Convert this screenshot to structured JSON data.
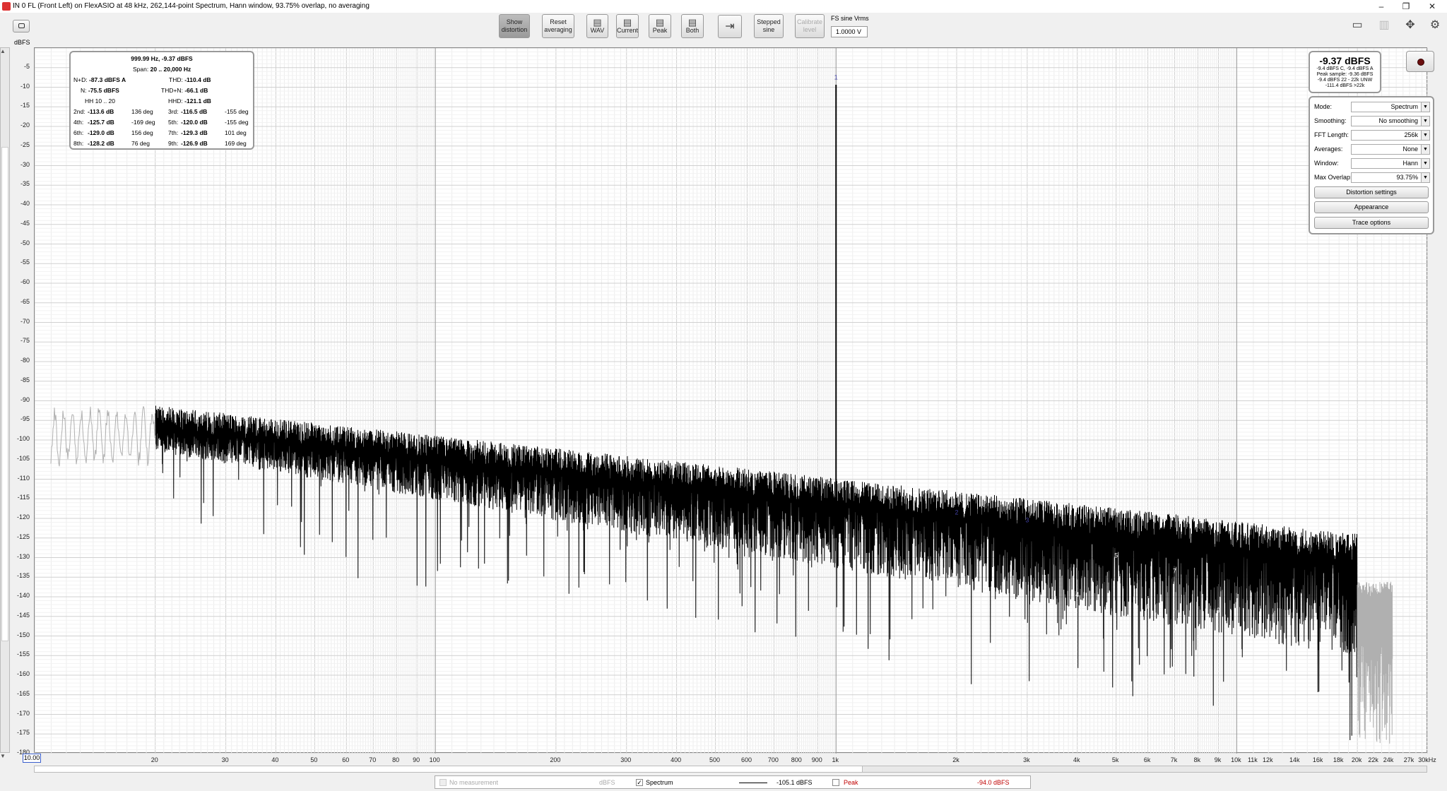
{
  "window": {
    "title": "IN 0 FL (Front Left) on FlexASIO at 48 kHz, 262,144-point Spectrum, Hann window, 93.75% overlap, no averaging",
    "min_glyph": "–",
    "max_glyph": "❐",
    "close_glyph": "✕"
  },
  "toolbar": {
    "show_distortion": [
      "Show",
      "distortion"
    ],
    "reset_averaging": [
      "Reset",
      "averaging"
    ],
    "wav": "WAV",
    "current": "Current",
    "peak": "Peak",
    "both": "Both",
    "stepped_sine": [
      "Stepped",
      "sine"
    ],
    "calibrate_level": [
      "Calibrate",
      "level"
    ],
    "fs_sine_label": "FS sine Vrms",
    "fs_sine_value": "1.0000 V"
  },
  "plot": {
    "y_unit": "dBFS",
    "y_ticks": [
      "-5",
      "-10",
      "-15",
      "-20",
      "-25",
      "-30",
      "-35",
      "-40",
      "-45",
      "-50",
      "-55",
      "-60",
      "-65",
      "-70",
      "-75",
      "-80",
      "-85",
      "-90",
      "-95",
      "-100",
      "-105",
      "-110",
      "-115",
      "-120",
      "-125",
      "-130",
      "-135",
      "-140",
      "-145",
      "-150",
      "-155",
      "-160",
      "-165",
      "-170",
      "-175",
      "-180"
    ],
    "x_start_box": "10.00",
    "x_ticks": [
      "20",
      "30",
      "40",
      "50",
      "60",
      "70",
      "80",
      "90",
      "100",
      "200",
      "300",
      "400",
      "500",
      "600",
      "700",
      "800",
      "900",
      "1k",
      "2k",
      "3k",
      "4k",
      "5k",
      "6k",
      "7k",
      "8k",
      "9k",
      "10k",
      "11k",
      "12k",
      "14k",
      "16k",
      "18k",
      "20k",
      "22k",
      "24k",
      "27k",
      "30kHz"
    ],
    "harmonic_markers": [
      "1",
      "2",
      "3",
      "4",
      "5",
      "6",
      "7",
      "8",
      "9"
    ]
  },
  "info_panel": {
    "header": "999.99 Hz, -9.37 dBFS",
    "span_label": "Span:",
    "span_value": "20 .. 20,000 Hz",
    "nd_label": "N+D:",
    "nd_value": "-87.3 dBFS A",
    "thd_label": "THD:",
    "thd_value": "-110.4 dB",
    "n_label": "N:",
    "n_value": "-75.5 dBFS",
    "thdn_label": "THD+N:",
    "thdn_value": "-66.1 dB",
    "hh_label": "HH 10 .. 20",
    "hhd_label": "HHD:",
    "hhd_value": "-121.1 dB",
    "harmonics": [
      {
        "l": "2nd:",
        "v": "-113.6 dB",
        "p": "136 deg",
        "l2": "3rd:",
        "v2": "-116.5 dB",
        "p2": "-155 deg"
      },
      {
        "l": "4th:",
        "v": "-125.7 dB",
        "p": "-169 deg",
        "l2": "5th:",
        "v2": "-120.0 dB",
        "p2": "-155 deg"
      },
      {
        "l": "6th:",
        "v": "-129.0 dB",
        "p": "156 deg",
        "l2": "7th:",
        "v2": "-129.3 dB",
        "p2": "101 deg"
      },
      {
        "l": "8th:",
        "v": "-128.2 dB",
        "p": "76 deg",
        "l2": "9th:",
        "v2": "-126.9 dB",
        "p2": "169 deg"
      }
    ]
  },
  "meter": {
    "big": "-9.37 dBFS",
    "lines": [
      "-9.4 dBFS C, -9.4 dBFS A",
      "Peak sample: -9.36 dBFS",
      "-9.4 dBFS 22 - 22k UNW",
      "-111.4 dBFS >22k"
    ]
  },
  "controls": {
    "rows": [
      {
        "label": "Mode:",
        "value": "Spectrum"
      },
      {
        "label": "Smoothing:",
        "value": "No  smoothing"
      },
      {
        "label": "FFT Length:",
        "value": "256k"
      },
      {
        "label": "Averages:",
        "value": "None"
      },
      {
        "label": "Window:",
        "value": "Hann"
      },
      {
        "label": "Max Overlap:",
        "value": "93.75%"
      }
    ],
    "buttons": [
      "Distortion settings",
      "Appearance",
      "Trace options"
    ]
  },
  "status": {
    "no_measurement": "No measurement",
    "no_meas_unit": "dBFS",
    "spectrum_label": "Spectrum",
    "spectrum_value": "-105.1 dBFS",
    "peak_label": "Peak",
    "peak_value": "-94.0 dBFS",
    "check": "✓"
  },
  "colors": {
    "trace": "#000000",
    "trace_light": "#b0b0b0",
    "peak_value": "#c00000"
  }
}
